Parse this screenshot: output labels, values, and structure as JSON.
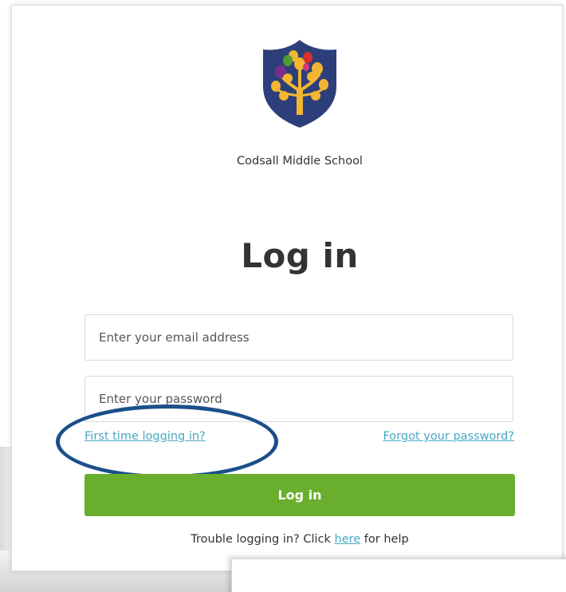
{
  "school": {
    "name": "Codsall Middle School",
    "crest_colors": {
      "shield": "#2c3f7a",
      "tree": "#f2b632",
      "red": "#d8302a",
      "green": "#4f9a33",
      "purple": "#7b2d8e",
      "pink": "#d63a7a"
    }
  },
  "form": {
    "heading": "Log in",
    "email_placeholder": "Enter your email address",
    "password_placeholder": "Enter your password",
    "first_time_link": "First time logging in?",
    "forgot_link": "Forgot your password?",
    "submit_label": "Log in",
    "button_color": "#6aae2e",
    "link_color": "#47a7c4"
  },
  "help": {
    "prefix": "Trouble logging in? Click ",
    "link": "here",
    "suffix": " for help"
  },
  "annotation": {
    "ellipse_color": "#1b4f8a"
  }
}
